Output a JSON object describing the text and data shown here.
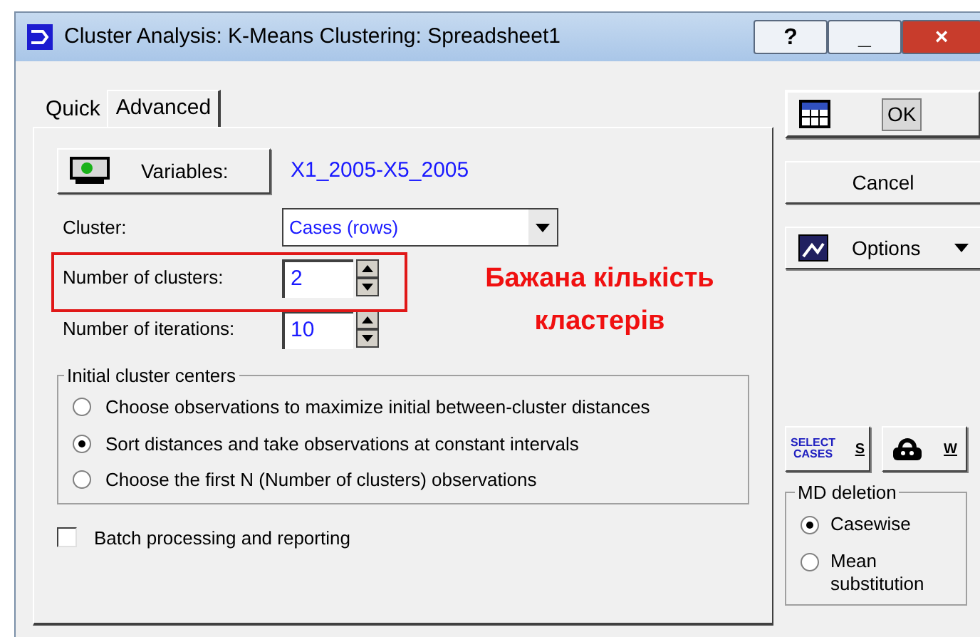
{
  "window": {
    "title": "Cluster Analysis: K-Means Clustering: Spreadsheet1",
    "controls": [
      "?",
      "_",
      "×"
    ]
  },
  "tabs": [
    {
      "label": "Quick",
      "selected": false
    },
    {
      "label": "Advanced",
      "selected": true
    }
  ],
  "variables": {
    "button": "Variables:",
    "value": "X1_2005-X5_2005"
  },
  "cluster": {
    "label": "Cluster:",
    "value": "Cases (rows)"
  },
  "num_clusters": {
    "label": "Number of clusters:",
    "value": "2",
    "highlighted": true
  },
  "num_iterations": {
    "label": "Number of iterations:",
    "value": "10"
  },
  "annotation": "Бажана кількість кластерів",
  "initial_centers": {
    "title": "Initial cluster centers",
    "options": [
      {
        "label": "Choose observations to maximize initial between-cluster distances",
        "selected": false
      },
      {
        "label": "Sort distances and take observations at constant intervals",
        "selected": true
      },
      {
        "label": "Choose the first N (Number of clusters) observations",
        "selected": false
      }
    ]
  },
  "batch": {
    "label": "Batch processing and reporting",
    "checked": false
  },
  "buttons": {
    "ok": "OK",
    "cancel": "Cancel",
    "options": "Options"
  },
  "select_cases": {
    "icon_lines": [
      "SELECT",
      "CASES"
    ],
    "key": "S"
  },
  "weights": {
    "key": "W"
  },
  "md_deletion": {
    "title": "MD deletion",
    "options": [
      {
        "label": "Casewise",
        "selected": true
      },
      {
        "label": "Mean substitution",
        "selected": false
      }
    ]
  }
}
